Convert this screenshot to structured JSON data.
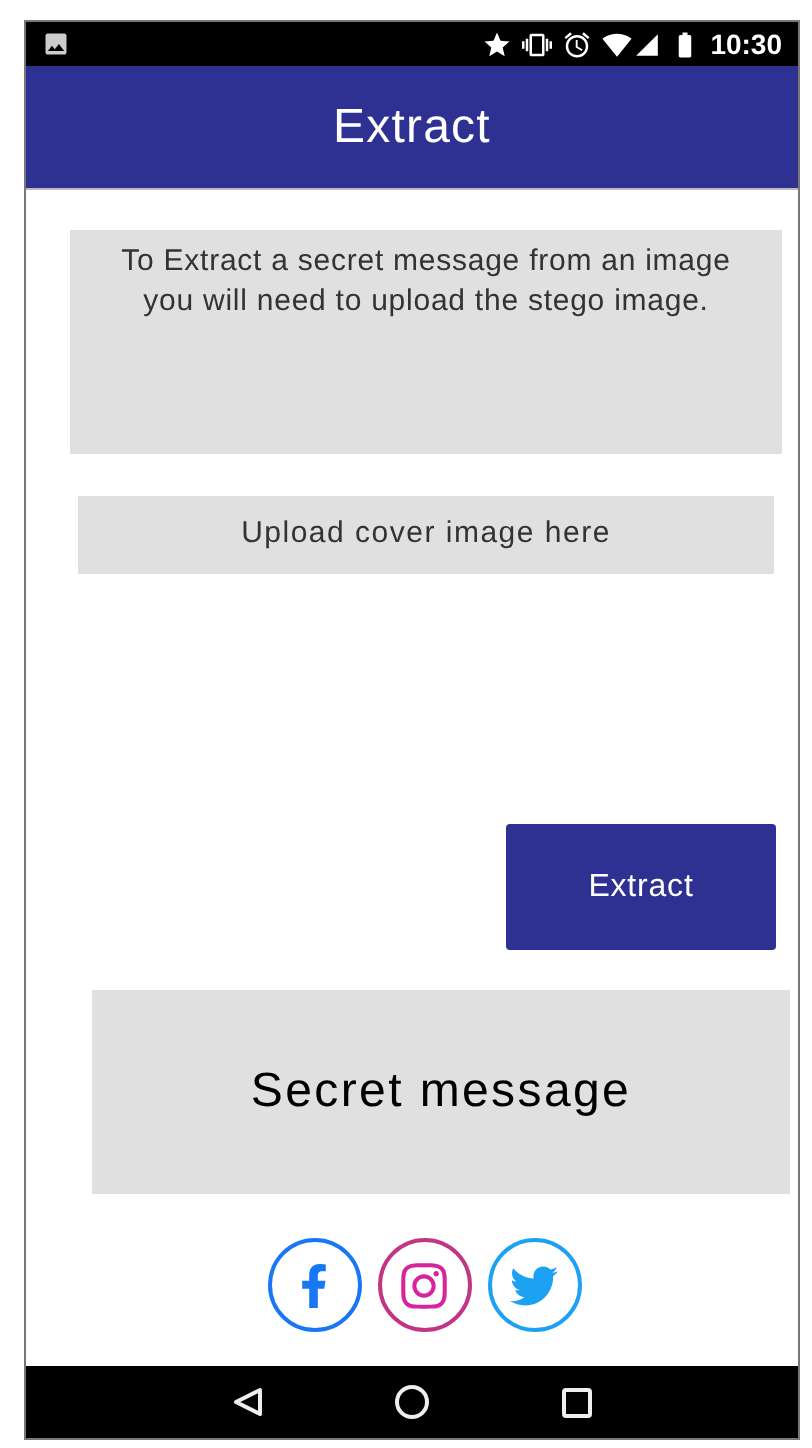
{
  "status_bar": {
    "time": "10:30"
  },
  "app_bar": {
    "title": "Extract"
  },
  "instructions": "To Extract a secret message from an image you will need to upload the stego image.",
  "upload": {
    "label": "Upload cover image here"
  },
  "extract_button": "Extract",
  "secret_message": "Secret message"
}
